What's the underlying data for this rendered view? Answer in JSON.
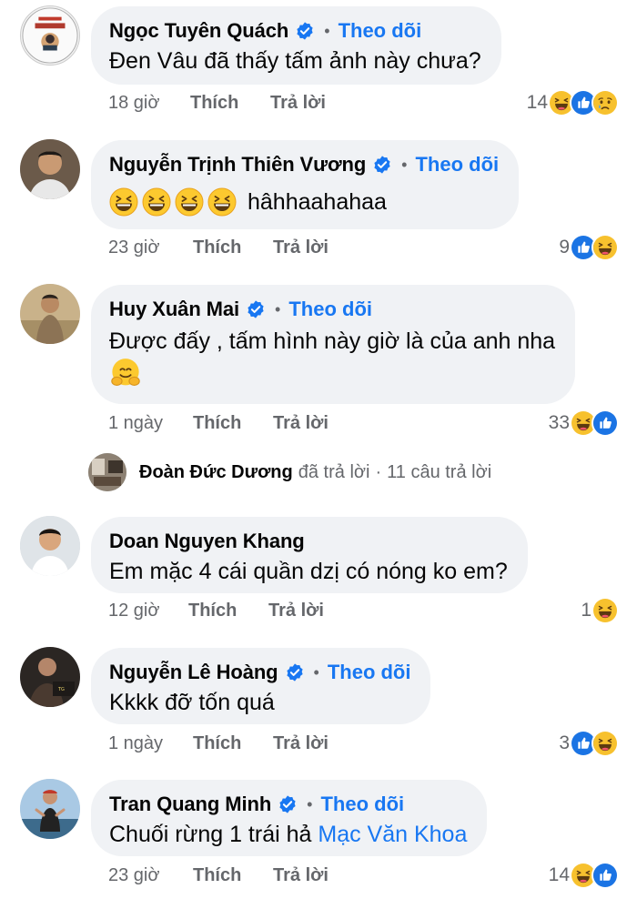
{
  "comments": [
    {
      "name": "Ngọc Tuyên Quách",
      "verified": true,
      "follow": "Theo dõi",
      "text": "Đen Vâu đã thấy tấm ảnh này chưa?",
      "time": "18 giờ",
      "like": "Thích",
      "reply": "Trả lời",
      "reaction_count": "14",
      "reactions": [
        "haha-icon",
        "like-icon",
        "sad-icon"
      ]
    },
    {
      "name": "Nguyễn Trịnh Thiên Vương",
      "verified": true,
      "follow": "Theo dõi",
      "text": "hâhhaahahaa",
      "emoji_prefix": [
        "laughing-emoji",
        "laughing-emoji",
        "laughing-emoji",
        "laughing-emoji"
      ],
      "time": "23 giờ",
      "like": "Thích",
      "reply": "Trả lời",
      "reaction_count": "9",
      "reactions": [
        "like-icon",
        "haha-icon"
      ]
    },
    {
      "name": "Huy Xuân Mai",
      "verified": true,
      "follow": "Theo dõi",
      "text": "Được đấy , tấm hình này giờ là của anh nha",
      "emoji_suffix": "hugging-emoji",
      "time": "1 ngày",
      "like": "Thích",
      "reply": "Trả lời",
      "reaction_count": "33",
      "reactions": [
        "haha-icon",
        "like-icon"
      ]
    },
    {
      "name": "Doan Nguyen Khang",
      "verified": false,
      "text": "Em mặc 4 cái quần dzị có nóng ko em?",
      "time": "12 giờ",
      "like": "Thích",
      "reply": "Trả lời",
      "reaction_count": "1",
      "reactions": [
        "haha-icon"
      ]
    },
    {
      "name": "Nguyễn Lê Hoàng",
      "verified": true,
      "follow": "Theo dõi",
      "text": "Kkkk đỡ tốn quá",
      "time": "1 ngày",
      "like": "Thích",
      "reply": "Trả lời",
      "reaction_count": "3",
      "reactions": [
        "like-icon",
        "haha-icon"
      ]
    },
    {
      "name": "Tran Quang Minh",
      "verified": true,
      "follow": "Theo dõi",
      "text": "Chuối rừng 1 trái hả",
      "mention": "Mạc Văn Khoa",
      "time": "23 giờ",
      "like": "Thích",
      "reply": "Trả lời",
      "reaction_count": "14",
      "reactions": [
        "haha-icon",
        "like-icon"
      ]
    }
  ],
  "reply_summary": {
    "name": "Đoàn Đức Dương",
    "action": "đã trả lời",
    "separator": "·",
    "count": "11 câu trả lời"
  },
  "colors": {
    "bubble": "#f0f2f5",
    "link": "#1877f2",
    "secondary_text": "#65676b"
  }
}
